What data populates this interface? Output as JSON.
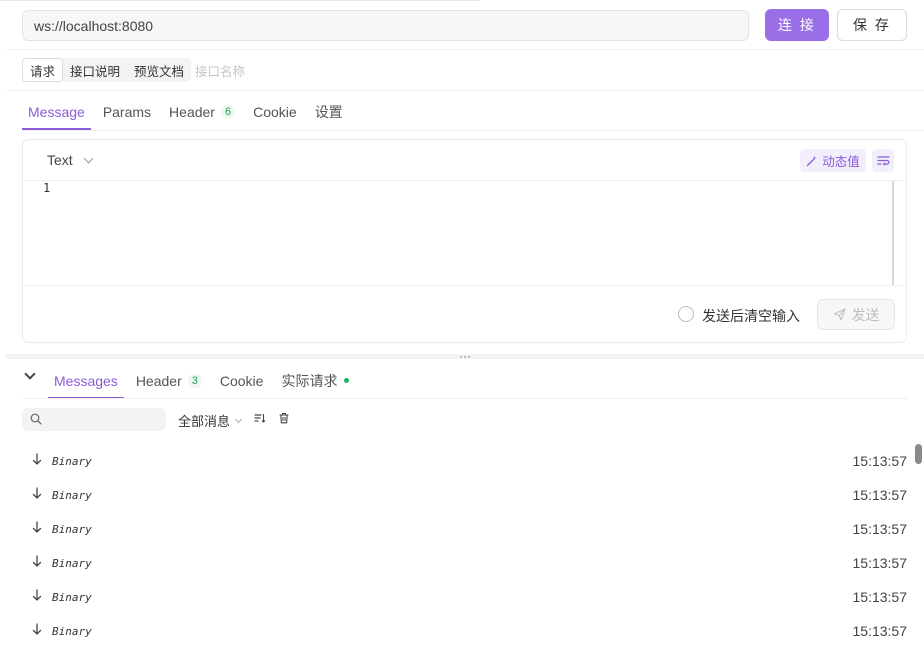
{
  "url": {
    "value": "ws://localhost:8080"
  },
  "buttons": {
    "connect": "连 接",
    "save": "保 存"
  },
  "subtabs": [
    {
      "label": "请求"
    },
    {
      "label": "接口说明"
    },
    {
      "label": "预览文档"
    }
  ],
  "api_name_placeholder": "接口名称",
  "tabs": [
    {
      "label": "Message",
      "active": true
    },
    {
      "label": "Params"
    },
    {
      "label": "Header",
      "badge": "6"
    },
    {
      "label": "Cookie"
    },
    {
      "label": "设置"
    }
  ],
  "editor": {
    "type_label": "Text",
    "dynamic_value_label": "动态值",
    "line_number": "1",
    "clear_after_send_label": "发送后清空输入",
    "send_label": "发送"
  },
  "bottom_tabs": [
    {
      "label": "Messages",
      "active": true
    },
    {
      "label": "Header",
      "badge": "3"
    },
    {
      "label": "Cookie"
    },
    {
      "label": "实际请求"
    }
  ],
  "filter": {
    "selected": "全部消息"
  },
  "messages": [
    {
      "kind": "Binary",
      "time": "15:13:57"
    },
    {
      "kind": "Binary",
      "time": "15:13:57"
    },
    {
      "kind": "Binary",
      "time": "15:13:57"
    },
    {
      "kind": "Binary",
      "time": "15:13:57"
    },
    {
      "kind": "Binary",
      "time": "15:13:57"
    },
    {
      "kind": "Binary",
      "time": "15:13:57"
    }
  ],
  "colors": {
    "accent": "#8a5cd8",
    "connect_bg": "#9a6ee6",
    "status_green": "#22b35e"
  },
  "icons": {
    "collapse": "chevron-down-icon",
    "dynamic": "magic-wand-icon",
    "wrap": "text-wrap-icon",
    "send": "paper-plane-icon",
    "search": "search-icon",
    "sort": "sort-icon",
    "trash": "trash-icon",
    "incoming": "arrow-down-icon"
  }
}
